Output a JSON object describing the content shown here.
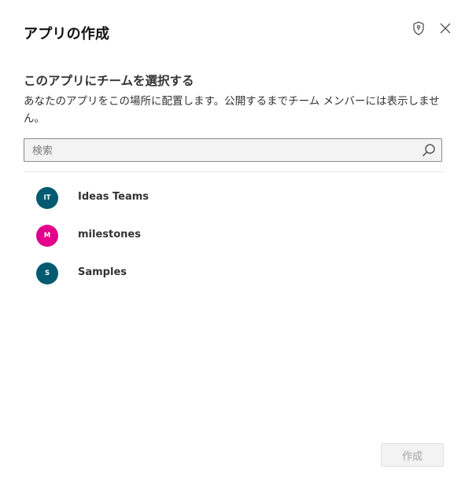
{
  "dialog": {
    "title": "アプリの作成",
    "subtitle": "このアプリにチームを選択する",
    "description": "あなたのアプリをこの場所に配置します。公開するまでチーム メンバーには表示しません。",
    "search": {
      "placeholder": "検索",
      "value": ""
    },
    "teams": [
      {
        "initials": "IT",
        "name": "Ideas Teams",
        "color": "#005b70"
      },
      {
        "initials": "M",
        "name": "milestones",
        "color": "#e3008c"
      },
      {
        "initials": "S",
        "name": "Samples",
        "color": "#005b70"
      }
    ],
    "create_label": "作成",
    "icons": {
      "shield": "shield-icon",
      "close": "close-icon",
      "search": "search-icon"
    }
  }
}
